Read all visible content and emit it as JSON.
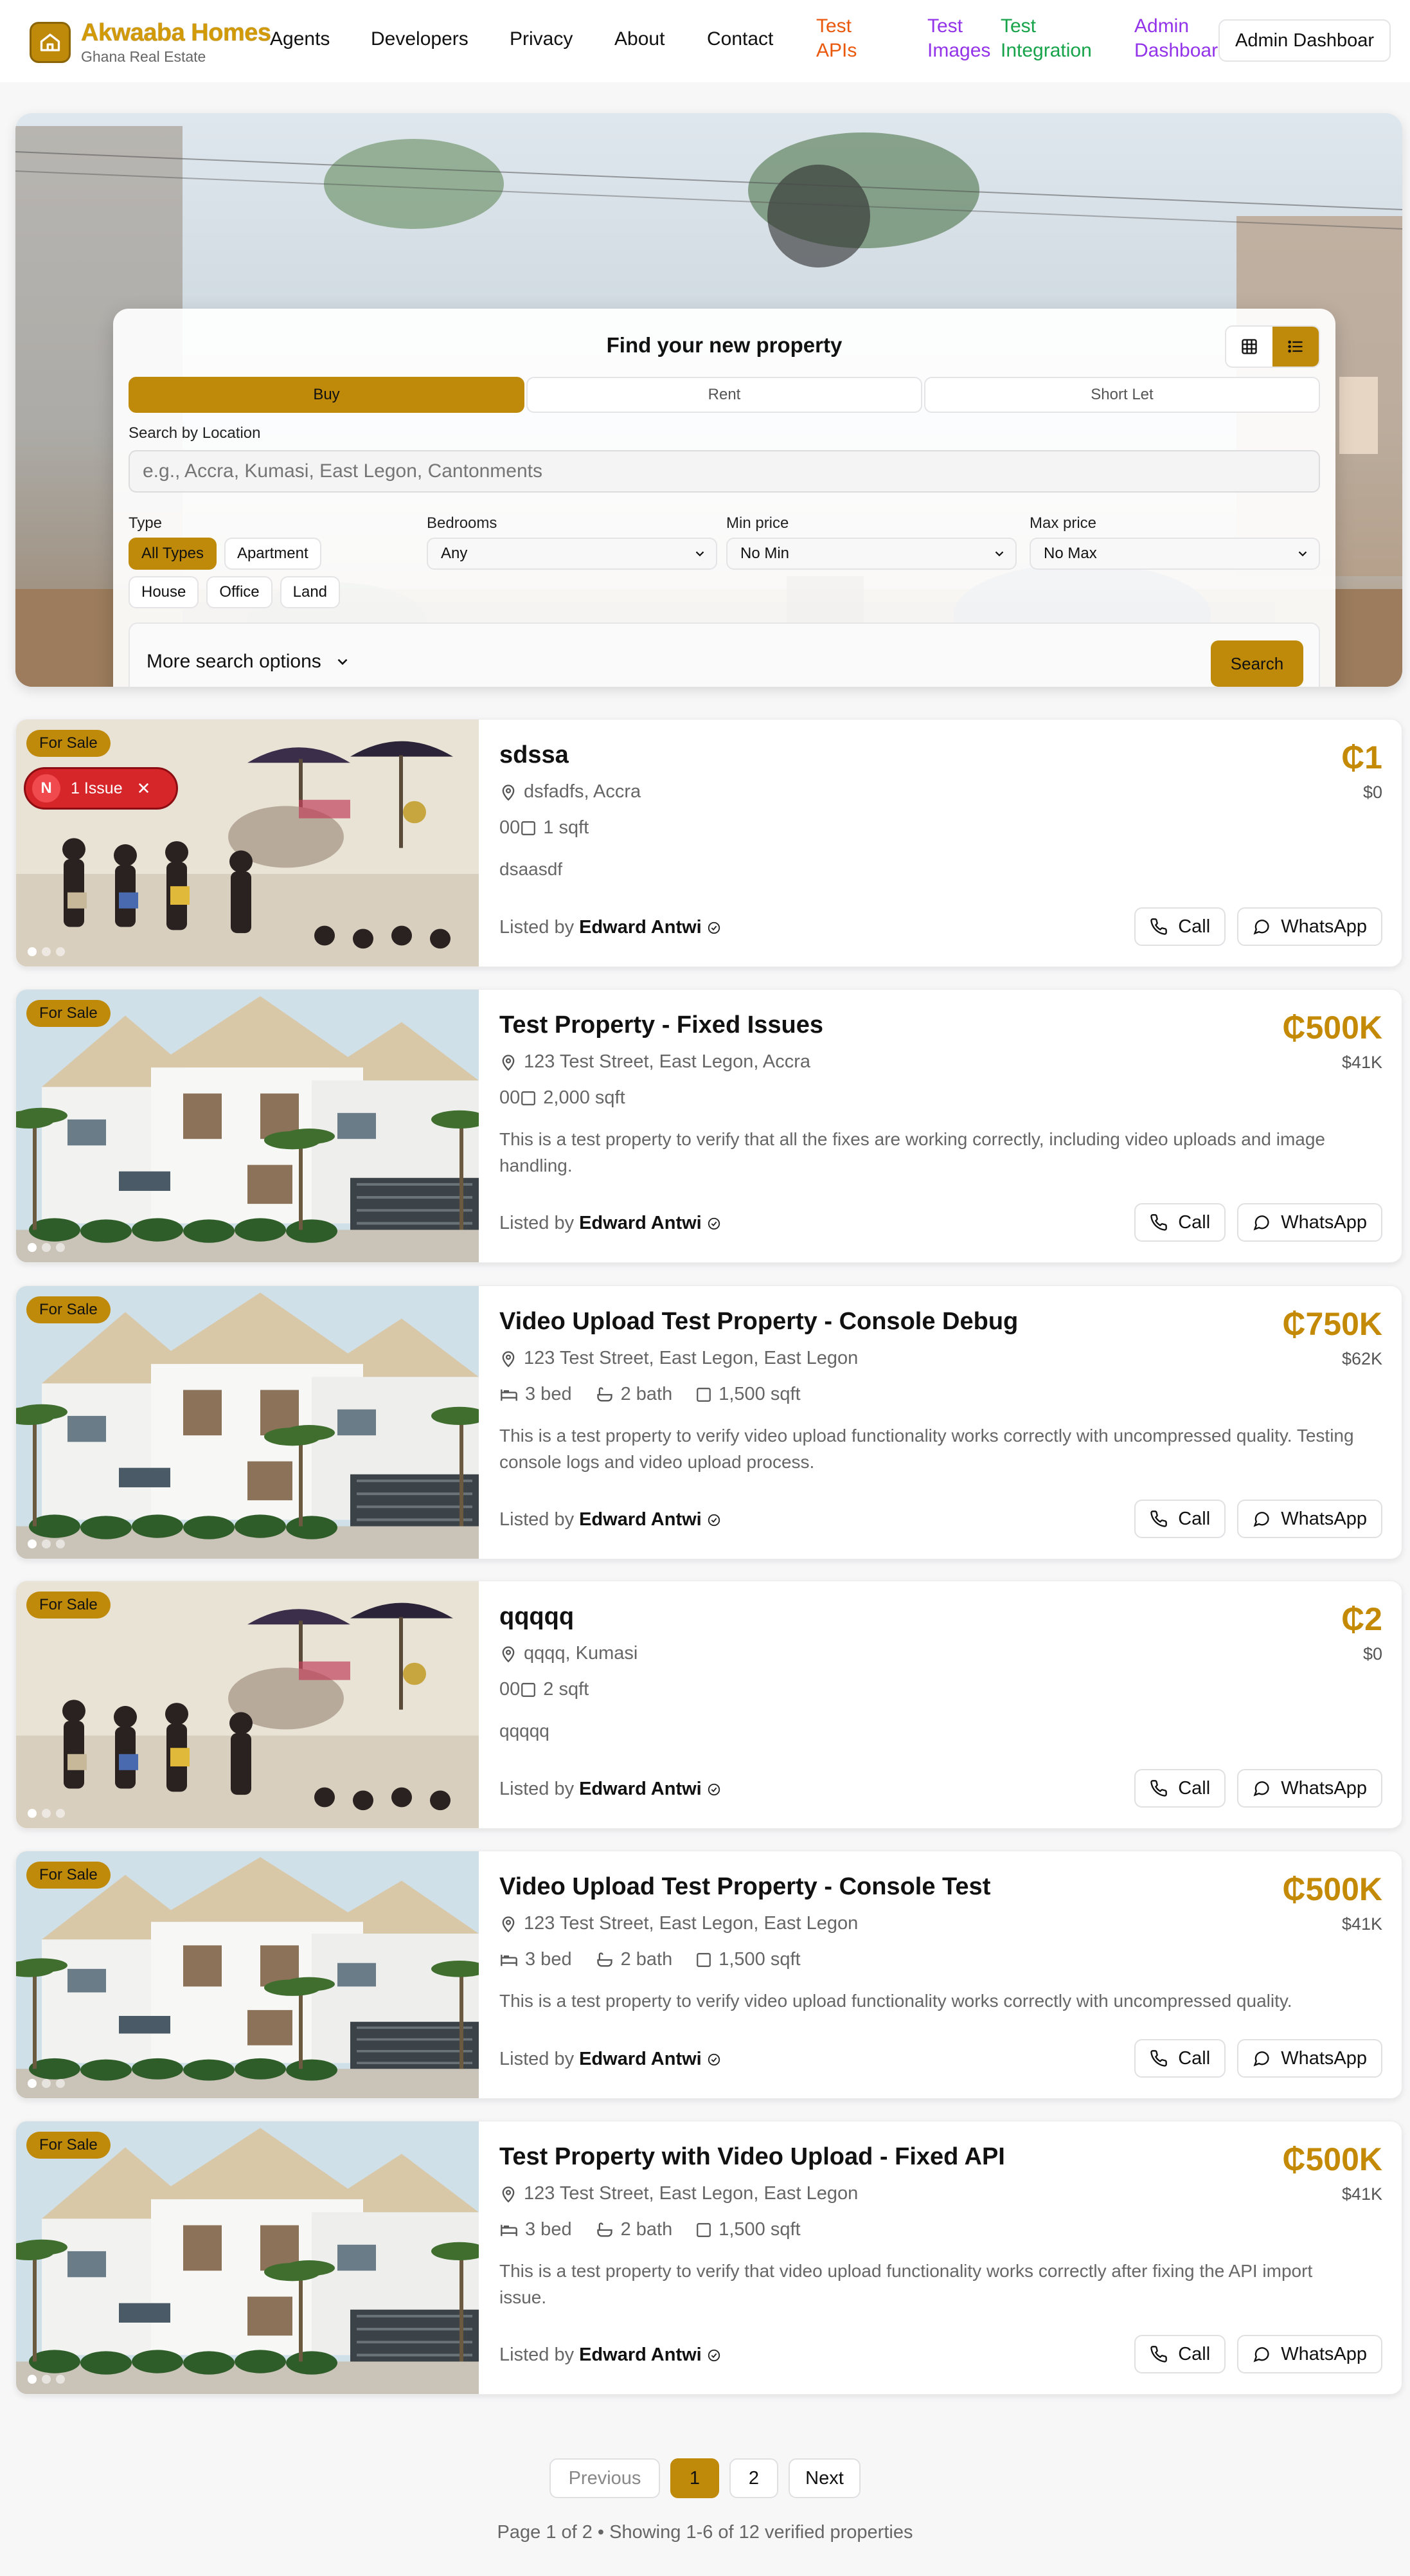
{
  "brand": {
    "name": "Akwaaba Homes",
    "tagline": "Ghana Real Estate"
  },
  "nav": {
    "links": [
      "Agents",
      "Developers",
      "Privacy",
      "About",
      "Contact"
    ],
    "test_links": [
      {
        "line1": "Test",
        "line2": "APIs",
        "color": "#ea580c"
      },
      {
        "line1": "Test",
        "line2": "Images",
        "color": "#9333ea"
      },
      {
        "line1": "Test",
        "line2": "Integration",
        "color": "#16a34a"
      },
      {
        "line1": "Admin",
        "line2": "Dashboard",
        "color": "#9333ea"
      }
    ],
    "admin_button": "Admin Dashboar"
  },
  "search": {
    "title": "Find your new property",
    "view_modes": [
      {
        "icon": "grid-icon",
        "active": false
      },
      {
        "icon": "list-icon",
        "active": true
      }
    ],
    "tabs": [
      {
        "label": "Buy",
        "active": true
      },
      {
        "label": "Rent",
        "active": false
      },
      {
        "label": "Short Let",
        "active": false
      }
    ],
    "location_label": "Search by Location",
    "location_placeholder": "e.g., Accra, Kumasi, East Legon, Cantonments",
    "type_label": "Type",
    "types": [
      {
        "label": "All Types",
        "active": true
      },
      {
        "label": "Apartment",
        "active": false
      },
      {
        "label": "House",
        "active": false
      },
      {
        "label": "Office",
        "active": false
      },
      {
        "label": "Land",
        "active": false
      }
    ],
    "bedrooms_label": "Bedrooms",
    "bedrooms_value": "Any",
    "min_price_label": "Min price",
    "min_price_value": "No Min",
    "max_price_label": "Max price",
    "max_price_value": "No Max",
    "more_options": "More search options",
    "search_button": "Search"
  },
  "listings": [
    {
      "badge": "For Sale",
      "title": "sdssa",
      "price": "₵1",
      "price_usd": "$0",
      "location": "dsfadfs, Accra",
      "beds": "",
      "baths": "",
      "sqft": "1 sqft",
      "prefix": "00",
      "description": "dsaasdf",
      "lister_prefix": "Listed by",
      "lister": "Edward Antwi",
      "image": "ceremony",
      "issue": {
        "n": "N",
        "label": "1 Issue"
      }
    },
    {
      "badge": "For Sale",
      "title": "Test Property - Fixed Issues",
      "price": "₵500K",
      "price_usd": "$41K",
      "location": "123 Test Street, East Legon, Accra",
      "beds": "",
      "baths": "",
      "sqft": "2,000 sqft",
      "prefix": "00",
      "description": "This is a test property to verify that all the fixes are working correctly, including video uploads and image handling.",
      "lister_prefix": "Listed by",
      "lister": "Edward Antwi",
      "image": "villa"
    },
    {
      "badge": "For Sale",
      "title": "Video Upload Test Property - Console Debug",
      "price": "₵750K",
      "price_usd": "$62K",
      "location": "123 Test Street, East Legon, East Legon",
      "beds": "3 bed",
      "baths": "2 bath",
      "sqft": "1,500 sqft",
      "prefix": "",
      "description": "This is a test property to verify video upload functionality works correctly with uncompressed quality. Testing console logs and video upload process.",
      "lister_prefix": "Listed by",
      "lister": "Edward Antwi",
      "image": "villa"
    },
    {
      "badge": "For Sale",
      "title": "qqqqq",
      "price": "₵2",
      "price_usd": "$0",
      "location": "qqqq, Kumasi",
      "beds": "",
      "baths": "",
      "sqft": "2 sqft",
      "prefix": "00",
      "description": "qqqqq",
      "lister_prefix": "Listed by",
      "lister": "Edward Antwi",
      "image": "ceremony"
    },
    {
      "badge": "For Sale",
      "title": "Video Upload Test Property - Console Test",
      "price": "₵500K",
      "price_usd": "$41K",
      "location": "123 Test Street, East Legon, East Legon",
      "beds": "3 bed",
      "baths": "2 bath",
      "sqft": "1,500 sqft",
      "prefix": "",
      "description": "This is a test property to verify video upload functionality works correctly with uncompressed quality.",
      "lister_prefix": "Listed by",
      "lister": "Edward Antwi",
      "image": "villa"
    },
    {
      "badge": "For Sale",
      "title": "Test Property with Video Upload - Fixed API",
      "price": "₵500K",
      "price_usd": "$41K",
      "location": "123 Test Street, East Legon, East Legon",
      "beds": "3 bed",
      "baths": "2 bath",
      "sqft": "1,500 sqft",
      "prefix": "",
      "description": "This is a test property to verify that video upload functionality works correctly after fixing the API import issue.",
      "lister_prefix": "Listed by",
      "lister": "Edward Antwi",
      "image": "villa"
    }
  ],
  "actions": {
    "call": "Call",
    "whatsapp": "WhatsApp"
  },
  "pagination": {
    "previous": "Previous",
    "pages": [
      "1",
      "2"
    ],
    "current": "1",
    "next": "Next",
    "status": "Page 1 of 2 • Showing 1-6 of 12 verified properties"
  },
  "colors": {
    "accent": "#bf8a0a",
    "price": "#c48a06",
    "issue": "#d6262a"
  }
}
